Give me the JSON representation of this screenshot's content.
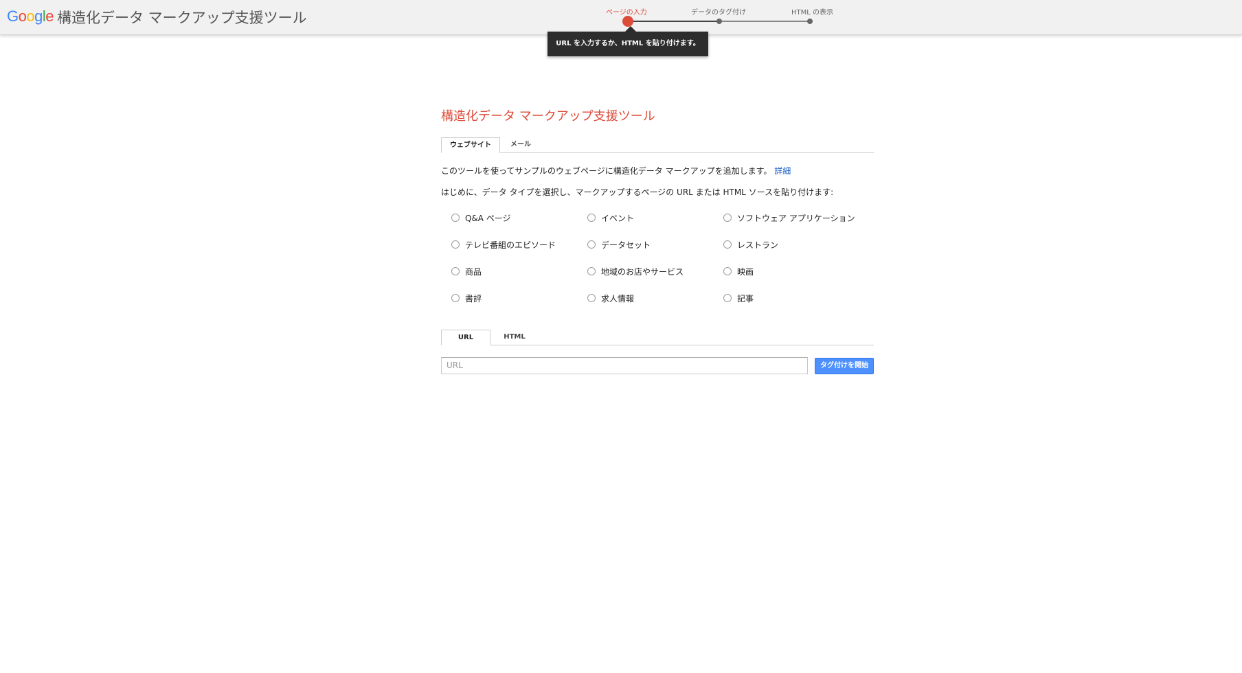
{
  "header": {
    "logo_text": "Google",
    "app_title": "構造化データ マークアップ支援ツール"
  },
  "stepper": {
    "steps": [
      {
        "label": "ページの入力",
        "active": true
      },
      {
        "label": "データのタグ付け",
        "active": false
      },
      {
        "label": "HTML の表示",
        "active": false
      }
    ],
    "tooltip": "URL を入力するか、HTML を貼り付けます。"
  },
  "main": {
    "title": "構造化データ マークアップ支援ツール",
    "type_tabs": [
      {
        "label": "ウェブサイト",
        "active": true
      },
      {
        "label": "メール",
        "active": false
      }
    ],
    "intro": "このツールを使ってサンプルのウェブページに構造化データ マークアップを追加します。",
    "details_link": "詳細",
    "instruction": "はじめに、データ タイプを選択し、マークアップするページの URL または HTML ソースを貼り付けます:",
    "data_types": [
      [
        "Q&A ページ",
        "イベント",
        "ソフトウェア アプリケーション"
      ],
      [
        "テレビ番組のエピソード",
        "データセット",
        "レストラン"
      ],
      [
        "商品",
        "地域のお店やサービス",
        "映画"
      ],
      [
        "書評",
        "求人情報",
        "記事"
      ]
    ],
    "source_tabs": [
      {
        "label": "URL",
        "active": true
      },
      {
        "label": "HTML",
        "active": false
      }
    ],
    "url_placeholder": "URL",
    "start_button": "タグ付けを開始"
  },
  "colors": {
    "accent": "#dd4b39",
    "button": "#4d90fe",
    "link": "#1a5fc8"
  }
}
